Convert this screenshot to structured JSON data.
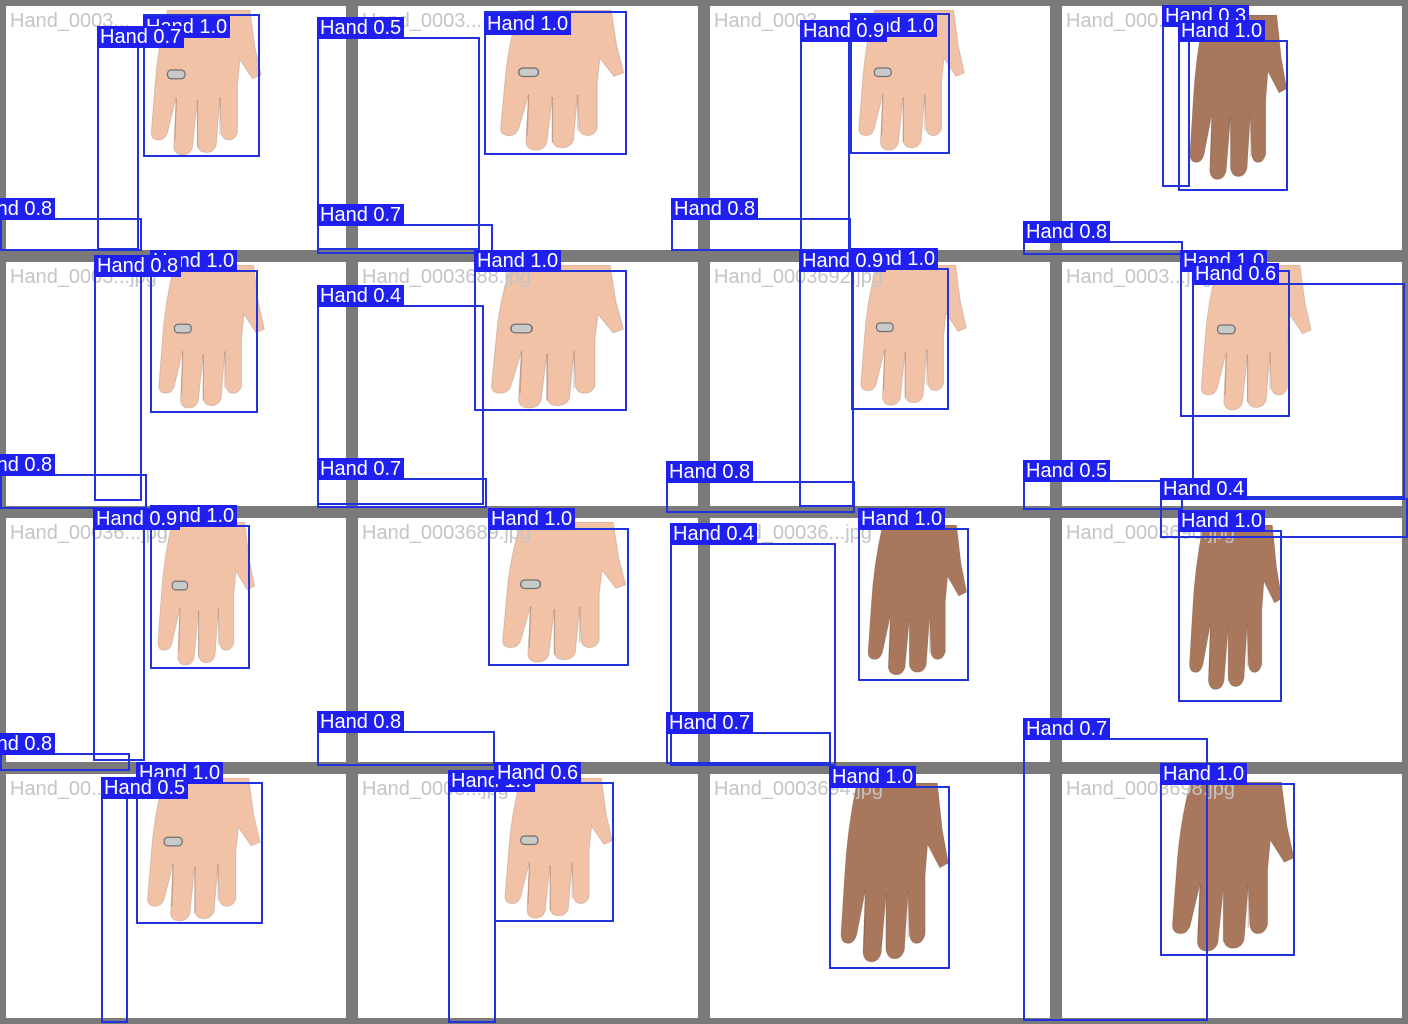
{
  "palette": {
    "box_color": "#2233dd",
    "label_bg": "#1f1ff0",
    "label_fg": "#ffffff",
    "tile_border": "#7a7a7a",
    "filename_color": "#c4c4c4",
    "skin_light": "#f1c2a6",
    "skin_dark": "#a9785c"
  },
  "tiles": [
    {
      "filename": "Hand_0003...",
      "skin": "light",
      "ring": true
    },
    {
      "filename": "Hand_0003...",
      "skin": "light",
      "ring": true
    },
    {
      "filename": "Hand_0003...",
      "skin": "light",
      "ring": true
    },
    {
      "filename": "Hand_000...",
      "skin": "dark",
      "ring": false
    },
    {
      "filename": "Hand_0003...jpg",
      "skin": "light",
      "ring": true
    },
    {
      "filename": "Hand_0003688.jpg",
      "skin": "light",
      "ring": true
    },
    {
      "filename": "Hand_0003692.jpg",
      "skin": "light",
      "ring": true
    },
    {
      "filename": "Hand_0003...jpg",
      "skin": "light",
      "ring": true
    },
    {
      "filename": "Hand_00036...jpg",
      "skin": "light",
      "ring": true
    },
    {
      "filename": "Hand_0003689.jpg",
      "skin": "light",
      "ring": true
    },
    {
      "filename": "Hand_00036...jpg",
      "skin": "dark",
      "ring": false
    },
    {
      "filename": "Hand_0003696.jpg",
      "skin": "dark",
      "ring": false
    },
    {
      "filename": "Hand_00...jpg",
      "skin": "light",
      "ring": true
    },
    {
      "filename": "Hand_0003...jpg",
      "skin": "light",
      "ring": true
    },
    {
      "filename": "Hand_0003694.jpg",
      "skin": "dark",
      "ring": false
    },
    {
      "filename": "Hand_0003698.jpg",
      "skin": "dark",
      "ring": false
    }
  ],
  "detections": [
    {
      "label": "Hand 1.0"
    },
    {
      "label": "Hand 0.7"
    },
    {
      "label": "Hand 0.5"
    },
    {
      "label": "Hand 1.0"
    },
    {
      "label": "Hand 1.0"
    },
    {
      "label": "Hand 0.9"
    },
    {
      "label": "Hand 0.3"
    },
    {
      "label": "Hand 1.0"
    },
    {
      "label": "Hand 0.8"
    },
    {
      "label": "Hand 0.7"
    },
    {
      "label": "Hand 0.8"
    },
    {
      "label": "Hand 0.8"
    },
    {
      "label": "Hand 1.0"
    },
    {
      "label": "Hand 0.8"
    },
    {
      "label": "Hand 0.4"
    },
    {
      "label": "Hand 1.0"
    },
    {
      "label": "Hand 1.0"
    },
    {
      "label": "Hand 0.9"
    },
    {
      "label": "Hand 1.0"
    },
    {
      "label": "Hand 0.6"
    },
    {
      "label": "Hand 0.8"
    },
    {
      "label": "Hand 0.7"
    },
    {
      "label": "Hand 0.8"
    },
    {
      "label": "Hand 0.5"
    },
    {
      "label": "Hand 0.4"
    },
    {
      "label": "Hand 1.0"
    },
    {
      "label": "Hand 0.9"
    },
    {
      "label": "Hand 1.0"
    },
    {
      "label": "Hand 0.4"
    },
    {
      "label": "Hand 1.0"
    },
    {
      "label": "Hand 1.0"
    },
    {
      "label": "Hand 0.8"
    },
    {
      "label": "Hand 0.8"
    },
    {
      "label": "Hand 0.7"
    },
    {
      "label": "Hand 0.7"
    },
    {
      "label": "Hand 1.0"
    },
    {
      "label": "Hand 0.5"
    },
    {
      "label": "Hand 1.0"
    },
    {
      "label": "Hand 0.6"
    },
    {
      "label": "Hand 1.0"
    },
    {
      "label": "Hand 1.0"
    }
  ]
}
